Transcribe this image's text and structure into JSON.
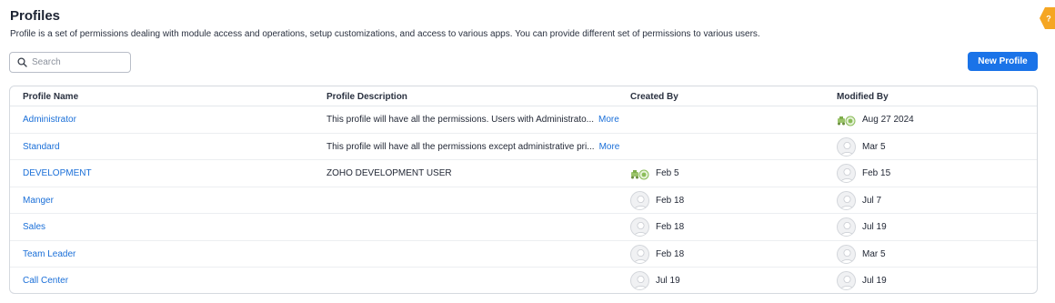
{
  "header": {
    "title": "Profiles",
    "subtitle": "Profile is a set of permissions dealing with module access and operations, setup customizations, and access to various apps. You can provide different set of permissions to various users."
  },
  "search": {
    "placeholder": "Search",
    "value": ""
  },
  "new_profile_button": "New Profile",
  "help_label": "?",
  "table": {
    "columns": [
      "Profile Name",
      "Profile Description",
      "Created By",
      "Modified By"
    ],
    "more_label": "More",
    "rows": [
      {
        "name": "Administrator",
        "description": "This profile will have all the permissions. Users with Administrato...",
        "has_more": true,
        "created": null,
        "created_icon": null,
        "modified": "Aug 27 2024",
        "modified_icon": "zoho-bot-icon"
      },
      {
        "name": "Standard",
        "description": "This profile will have all the permissions except administrative pri...",
        "has_more": true,
        "created": null,
        "created_icon": null,
        "modified": "Mar 5",
        "modified_icon": "avatar-icon"
      },
      {
        "name": "DEVELOPMENT",
        "description": "ZOHO DEVELOPMENT USER",
        "has_more": false,
        "created": "Feb 5",
        "created_icon": "zoho-bot-icon",
        "modified": "Feb 15",
        "modified_icon": "avatar-icon"
      },
      {
        "name": "Manger",
        "description": "",
        "has_more": false,
        "created": "Feb 18",
        "created_icon": "avatar-icon",
        "modified": "Jul 7",
        "modified_icon": "avatar-icon"
      },
      {
        "name": "Sales",
        "description": "",
        "has_more": false,
        "created": "Feb 18",
        "created_icon": "avatar-icon",
        "modified": "Jul 19",
        "modified_icon": "avatar-icon"
      },
      {
        "name": "Team Leader",
        "description": "",
        "has_more": false,
        "created": "Feb 18",
        "created_icon": "avatar-icon",
        "modified": "Mar 5",
        "modified_icon": "avatar-icon"
      },
      {
        "name": "Call Center",
        "description": "",
        "has_more": false,
        "created": "Jul 19",
        "created_icon": "avatar-icon",
        "modified": "Jul 19",
        "modified_icon": "avatar-icon"
      }
    ]
  },
  "colors": {
    "accent": "#1a73e8",
    "link": "#1a6fd8",
    "help_tab": "#f5a623"
  }
}
